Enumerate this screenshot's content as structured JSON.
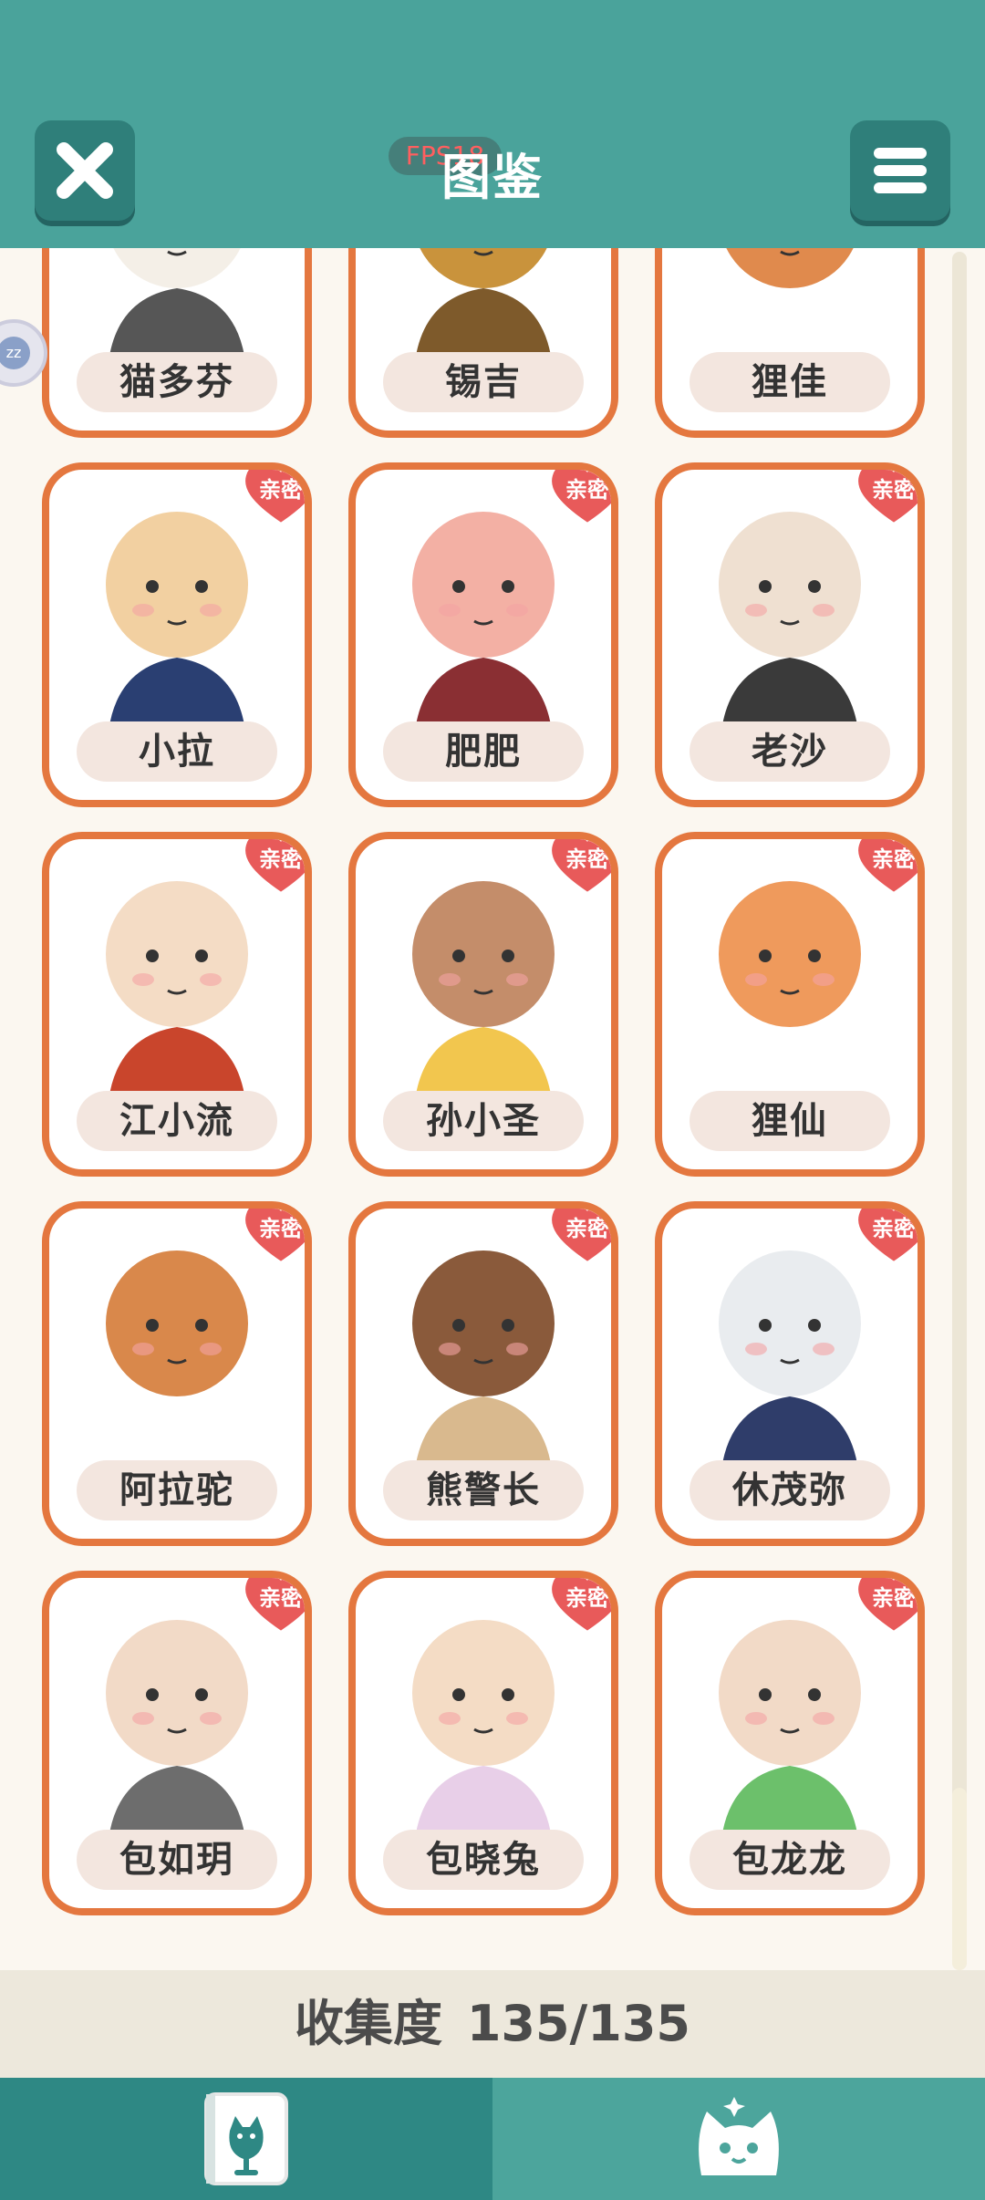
{
  "header": {
    "title": "图鉴",
    "fps": "FPS18"
  },
  "badge_label": "亲密",
  "characters": [
    {
      "name": "猫多芬",
      "intimate": false
    },
    {
      "name": "锡吉",
      "intimate": false
    },
    {
      "name": "狸佳",
      "intimate": false
    },
    {
      "name": "小拉",
      "intimate": true
    },
    {
      "name": "肥肥",
      "intimate": true
    },
    {
      "name": "老沙",
      "intimate": true
    },
    {
      "name": "江小流",
      "intimate": true
    },
    {
      "name": "孙小圣",
      "intimate": true
    },
    {
      "name": "狸仙",
      "intimate": true
    },
    {
      "name": "阿拉驼",
      "intimate": true
    },
    {
      "name": "熊警长",
      "intimate": true
    },
    {
      "name": "休茂弥",
      "intimate": true
    },
    {
      "name": "包如玥",
      "intimate": true
    },
    {
      "name": "包晓兔",
      "intimate": true
    },
    {
      "name": "包龙龙",
      "intimate": true
    }
  ],
  "collection": {
    "label": "收集度",
    "value": "135/135"
  },
  "tabs": [
    {
      "name": "book-tab",
      "active": true
    },
    {
      "name": "cat-tab",
      "active": false
    }
  ],
  "colors": {
    "header": "#4aa39b",
    "card_border": "#e4773f",
    "heart": "#e85a5a"
  }
}
